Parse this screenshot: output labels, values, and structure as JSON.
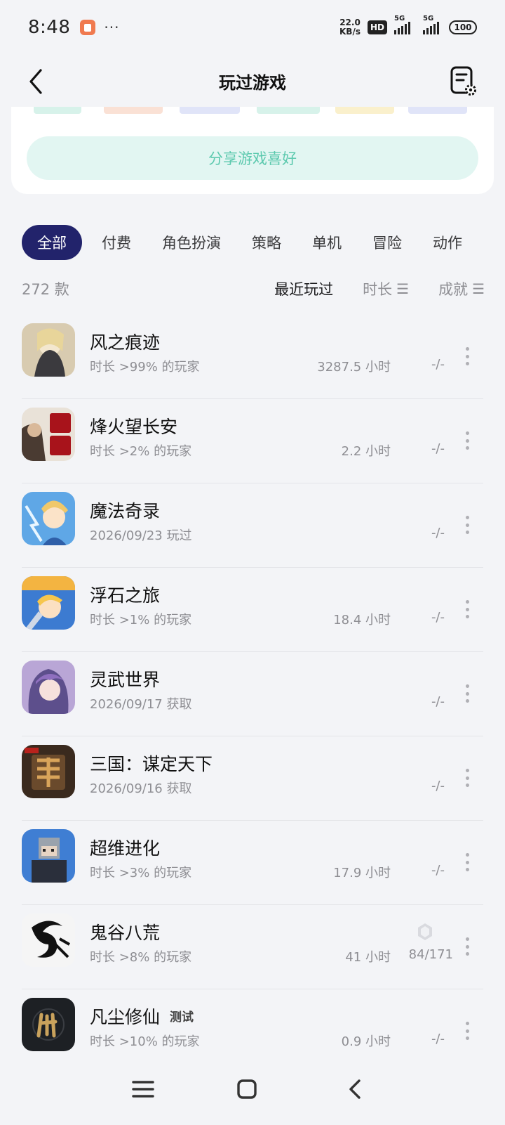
{
  "status": {
    "time": "8:48",
    "dots": "···",
    "net_speed_value": "22.0",
    "net_speed_unit": "KB/s",
    "hd": "HD",
    "sim1": "5G",
    "sim2": "5G",
    "battery": "100"
  },
  "header": {
    "title": "玩过游戏"
  },
  "share": {
    "label": "分享游戏喜好"
  },
  "categories": [
    {
      "label": "全部",
      "active": true
    },
    {
      "label": "付费"
    },
    {
      "label": "角色扮演"
    },
    {
      "label": "策略"
    },
    {
      "label": "单机"
    },
    {
      "label": "冒险"
    },
    {
      "label": "动作"
    }
  ],
  "sort": {
    "count": "272 款",
    "recent": "最近玩过",
    "duration": "时长",
    "achievement": "成就"
  },
  "games": [
    {
      "name": "风之痕迹",
      "sub": "时长 >99% 的玩家",
      "hours": "3287.5 小时",
      "ach": "-/-",
      "icon_colors": [
        "#d8cbb0",
        "#3b3a3e"
      ]
    },
    {
      "name": "烽火望长安",
      "sub": "时长 >2% 的玩家",
      "hours": "2.2 小时",
      "ach": "-/-",
      "icon_colors": [
        "#e9e2d8",
        "#a8131b"
      ]
    },
    {
      "name": "魔法奇录",
      "sub": "2026/09/23 玩过",
      "hours": "",
      "ach": "-/-",
      "icon_colors": [
        "#5fa7e6",
        "#f0c86a"
      ]
    },
    {
      "name": "浮石之旅",
      "sub": "时长 >1% 的玩家",
      "hours": "18.4 小时",
      "ach": "-/-",
      "icon_colors": [
        "#3c7bd1",
        "#f3b441"
      ]
    },
    {
      "name": "灵武世界",
      "sub": "2026/09/17 获取",
      "hours": "",
      "ach": "-/-",
      "icon_colors": [
        "#b9a6d6",
        "#5d4f8c"
      ]
    },
    {
      "name": "三国：谋定天下",
      "sub": "2026/09/16 获取",
      "hours": "",
      "ach": "-/-",
      "icon_colors": [
        "#3a2a1e",
        "#d9a45a"
      ]
    },
    {
      "name": "超维进化",
      "sub": "时长 >3% 的玩家",
      "hours": "17.9 小时",
      "ach": "-/-",
      "icon_colors": [
        "#3f7ed3",
        "#2a2f3b"
      ]
    },
    {
      "name": "鬼谷八荒",
      "sub": "时长 >8% 的玩家",
      "hours": "41 小时",
      "ach": "84/171",
      "icon_colors": [
        "#f5f5f5",
        "#111111"
      ]
    },
    {
      "name": "凡尘修仙",
      "tag": "测试",
      "sub": "时长 >10% 的玩家",
      "hours": "0.9 小时",
      "ach": "-/-",
      "icon_colors": [
        "#1d2024",
        "#c9a25c"
      ]
    }
  ],
  "colors": {
    "accent_dark": "#22236b",
    "share_bg": "#e2f6f2",
    "share_text": "#5cc9ae"
  }
}
